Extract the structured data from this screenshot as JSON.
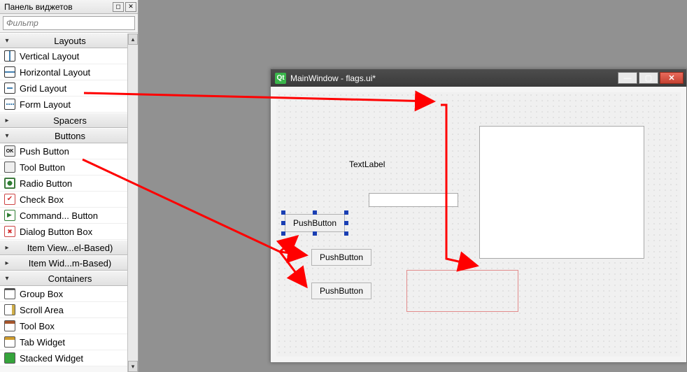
{
  "dock": {
    "title": "Панель виджетов",
    "filter_placeholder": "Фильтр",
    "categories": {
      "layouts": {
        "label": "Layouts",
        "expanded": true,
        "items": [
          "Vertical Layout",
          "Horizontal Layout",
          "Grid Layout",
          "Form Layout"
        ]
      },
      "spacers": {
        "label": "Spacers",
        "expanded": false
      },
      "buttons": {
        "label": "Buttons",
        "expanded": true,
        "items": [
          "Push Button",
          "Tool Button",
          "Radio Button",
          "Check Box",
          "Command... Button",
          "Dialog Button Box"
        ]
      },
      "item_views_model": {
        "label": "Item View...el-Based)",
        "expanded": false
      },
      "item_widgets_item": {
        "label": "Item Wid...m-Based)",
        "expanded": false
      },
      "containers": {
        "label": "Containers",
        "expanded": true,
        "items": [
          "Group Box",
          "Scroll Area",
          "Tool Box",
          "Tab Widget",
          "Stacked Widget"
        ]
      }
    }
  },
  "form": {
    "qt_badge": "Qt",
    "title": "MainWindow - flags.ui*",
    "widgets": {
      "textlabel": "TextLabel",
      "lineedit_value": "",
      "pushbutton_selected": "PushButton",
      "pushbutton_2": "PushButton",
      "pushbutton_3": "PushButton"
    }
  },
  "colors": {
    "annotation": "#ff0000"
  }
}
